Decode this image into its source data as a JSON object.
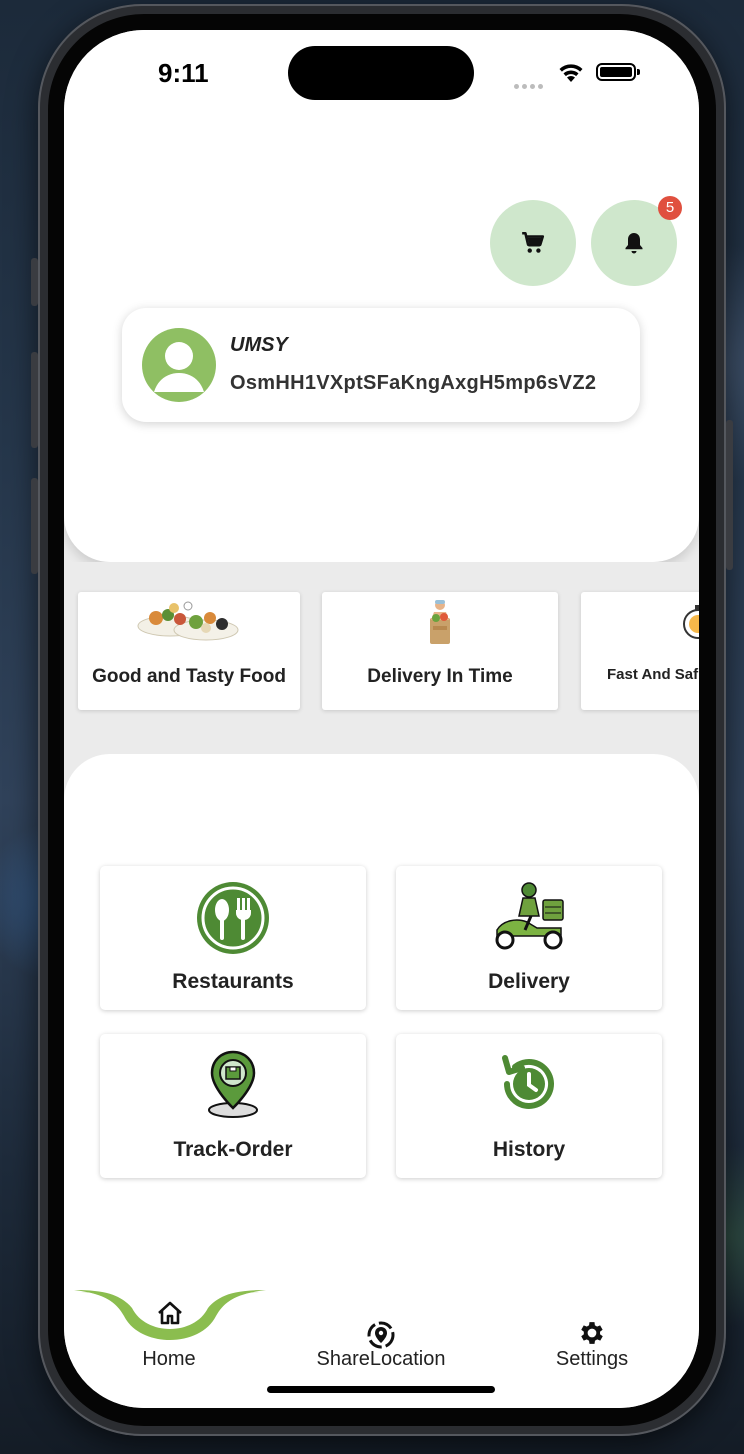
{
  "status_bar": {
    "time": "9:11"
  },
  "header": {
    "cart_icon": "cart-icon",
    "bell_icon": "bell-icon",
    "notification_count": "5"
  },
  "profile": {
    "name": "UMSY",
    "user_id": "OsmHH1VXptSFaKngAxgH5mp6sVZ2"
  },
  "features": [
    {
      "label": "Good and Tasty Food"
    },
    {
      "label": "Delivery In Time"
    },
    {
      "label": "Fast And Saf"
    }
  ],
  "tiles": [
    {
      "label": "Restaurants"
    },
    {
      "label": "Delivery"
    },
    {
      "label": "Track-Order"
    },
    {
      "label": "History"
    }
  ],
  "nav": [
    {
      "label": "Home",
      "icon": "home-icon",
      "active": true
    },
    {
      "label": "ShareLocation",
      "icon": "location-icon",
      "active": false
    },
    {
      "label": "Settings",
      "icon": "gear-icon",
      "active": false
    }
  ],
  "colors": {
    "accent_green": "#8bbd4f",
    "icon_green": "#4e8a34",
    "circle_bg": "#cfe7cc",
    "badge_red": "#e0503f"
  }
}
